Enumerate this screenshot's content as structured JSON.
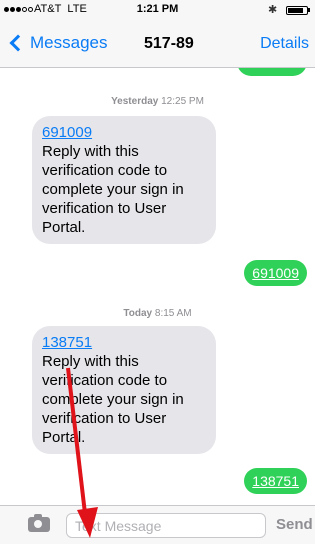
{
  "status_bar": {
    "carrier": "AT&T",
    "network": "LTE",
    "time": "1:21 PM",
    "signal_bars_filled": 3,
    "signal_bars_total": 5,
    "battery_level": 0.85
  },
  "nav": {
    "back_label": "Messages",
    "title": "517-89",
    "details_label": "Details"
  },
  "conversation": [
    {
      "type": "stamp",
      "day": "Yesterday",
      "time": "12:25 PM"
    },
    {
      "type": "incoming",
      "code": "691009",
      "lines": [
        "Reply with this",
        "verification code to",
        "complete your sign in",
        "verification to User",
        "Portal."
      ]
    },
    {
      "type": "outgoing",
      "text": "691009"
    },
    {
      "type": "stamp",
      "day": "Today",
      "time": "8:15 AM"
    },
    {
      "type": "incoming",
      "code": "138751",
      "lines": [
        "Reply with this",
        "verification code to",
        "complete your sign in",
        "verification to User",
        "Portal."
      ]
    },
    {
      "type": "outgoing",
      "text": "138751"
    }
  ],
  "input_bar": {
    "placeholder": "Text Message",
    "send_label": "Send"
  },
  "colors": {
    "accent": "#0a7cf5",
    "outgoing_bubble": "#30d158",
    "incoming_bubble": "#e5e5ea",
    "annotation_arrow": "#e0131b"
  }
}
